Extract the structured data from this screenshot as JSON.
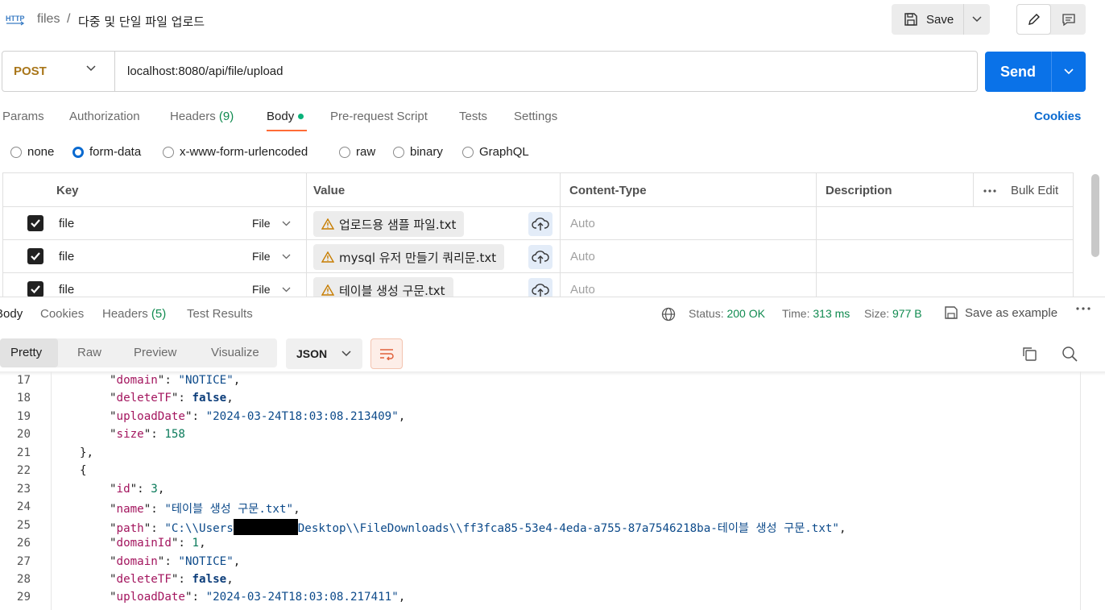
{
  "header": {
    "breadcrumb_parent": "files",
    "breadcrumb_sep": "/",
    "title": "다중 및 단일 파일 업로드",
    "save_label": "Save"
  },
  "request": {
    "method": "POST",
    "url": "localhost:8080/api/file/upload",
    "send_label": "Send"
  },
  "req_tabs": {
    "params": "Params",
    "authorization": "Authorization",
    "headers": "Headers",
    "headers_count": "(9)",
    "body": "Body",
    "pre_request": "Pre-request Script",
    "tests": "Tests",
    "settings": "Settings",
    "cookies": "Cookies"
  },
  "body_types": [
    "none",
    "form-data",
    "x-www-form-urlencoded",
    "raw",
    "binary",
    "GraphQL"
  ],
  "form_table": {
    "headers": {
      "key": "Key",
      "value": "Value",
      "content_type": "Content-Type",
      "description": "Description",
      "bulk_edit": "Bulk Edit"
    },
    "rows": [
      {
        "key": "file",
        "type": "File",
        "value": "업로드용 샘플 파일.txt",
        "content_type": "Auto"
      },
      {
        "key": "file",
        "type": "File",
        "value": "mysql 유저 만들기 쿼리문.txt",
        "content_type": "Auto"
      },
      {
        "key": "file",
        "type": "File",
        "value": "테이블 생성 구문.txt",
        "content_type": "Auto"
      }
    ]
  },
  "response": {
    "tabs": {
      "body": "Body",
      "cookies": "Cookies",
      "headers": "Headers",
      "headers_count": "(5)",
      "test_results": "Test Results"
    },
    "status_label": "Status:",
    "status_value": "200 OK",
    "time_label": "Time:",
    "time_value": "313 ms",
    "size_label": "Size:",
    "size_value": "977 B",
    "save_example": "Save as example",
    "views": [
      "Pretty",
      "Raw",
      "Preview",
      "Visualize"
    ],
    "format": "JSON"
  },
  "code_lines": [
    {
      "n": "17",
      "indent": 2,
      "key": "domain",
      "str": "NOTICE",
      "trail": ","
    },
    {
      "n": "18",
      "indent": 2,
      "key": "deleteTF",
      "bool": "false",
      "trail": ","
    },
    {
      "n": "19",
      "indent": 2,
      "key": "uploadDate",
      "str": "2024-03-24T18:03:08.213409",
      "trail": ","
    },
    {
      "n": "20",
      "indent": 2,
      "key": "size",
      "num": "158",
      "trail": ""
    },
    {
      "n": "21",
      "indent": 1,
      "punct": "},"
    },
    {
      "n": "22",
      "indent": 1,
      "punct": "{"
    },
    {
      "n": "23",
      "indent": 2,
      "key": "id",
      "num": "3",
      "trail": ","
    },
    {
      "n": "24",
      "indent": 2,
      "key": "name",
      "str": "테이블 생성 구문.txt",
      "trail": ","
    },
    {
      "n": "25",
      "indent": 2,
      "key": "path",
      "str_pre": "C:\\\\Users",
      "str_post": "Desktop\\\\FileDownloads\\\\ff3fca85-53e4-4eda-a755-87a7546218ba-테이블 생성 구문.txt",
      "trail": ","
    },
    {
      "n": "26",
      "indent": 2,
      "key": "domainId",
      "num": "1",
      "trail": ","
    },
    {
      "n": "27",
      "indent": 2,
      "key": "domain",
      "str": "NOTICE",
      "trail": ","
    },
    {
      "n": "28",
      "indent": 2,
      "key": "deleteTF",
      "bool": "false",
      "trail": ","
    },
    {
      "n": "29",
      "indent": 2,
      "key": "uploadDate",
      "str": "2024-03-24T18:03:08.217411",
      "trail": ","
    }
  ]
}
